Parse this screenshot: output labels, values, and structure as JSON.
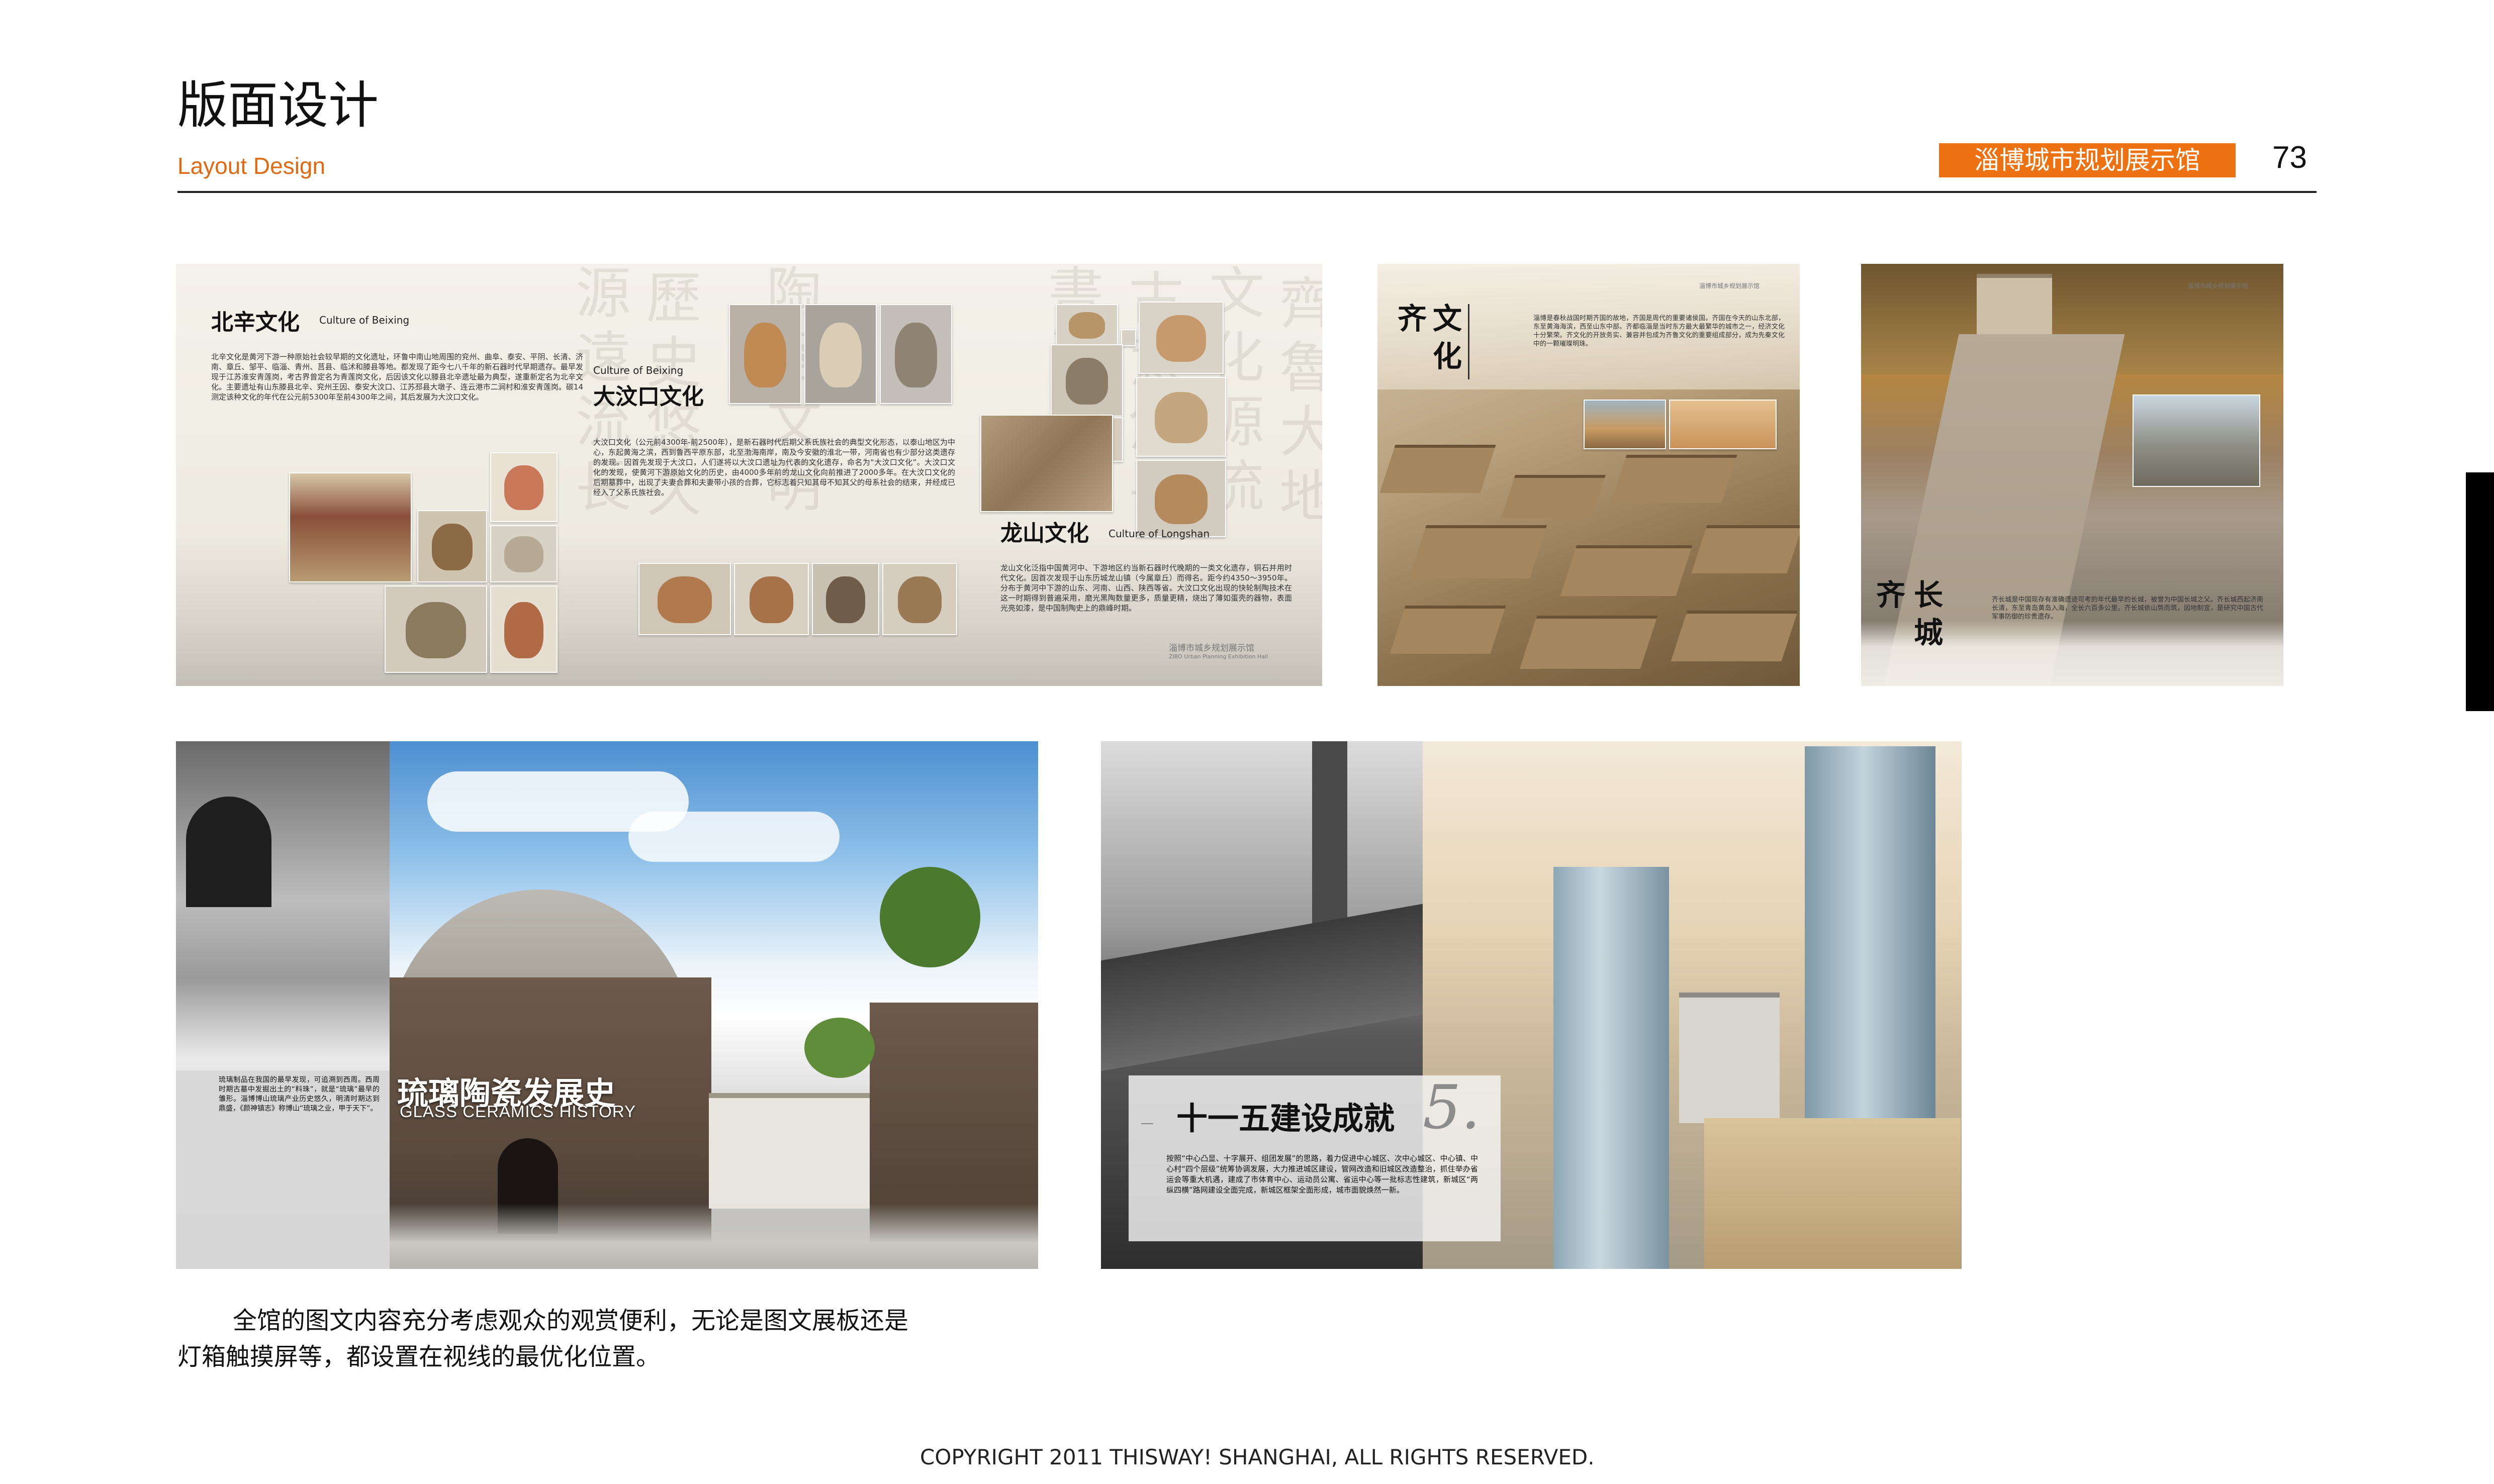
{
  "header": {
    "title_cn": "版面设计",
    "title_en": "Layout Design",
    "badge": "淄博城市规划展示馆",
    "page_number": "73"
  },
  "panel_culture": {
    "beixin": {
      "title": "北辛文化",
      "subtitle": "Culture of Beixing",
      "text": "北辛文化是黄河下游一种原始社会较早期的文化遗址，环鲁中南山地周围的兖州、曲阜、泰安、平阴、长清、济南、章丘、邹平、临淄、青州、莒县、临沭和滕县等地。都发现了距今七八千年的新石器时代早期遗存。最早发现于江苏淮安青莲岗，考古界曾定名为青莲岗文化，后因该文化以滕县北辛遗址最为典型，遂重新定名为北辛文化。主要遗址有山东滕县北辛、兖州王因、泰安大汶口、江苏邳县大墩子、连云港市二涧村和淮安青莲岗。碳14测定该种文化的年代在公元前5300年至前4300年之间，其后发展为大汶口文化。"
    },
    "dawenkou": {
      "subtitle": "Culture of Beixing",
      "title": "大汶口文化",
      "text": "大汶口文化（公元前4300年-前2500年），是新石器时代后期父系氏族社会的典型文化形态，以泰山地区为中心，东起黄海之滨，西到鲁西平原东部，北至渤海南岸，南及今安徽的淮北一带，河南省也有少部分这类遗存的发现。因首先发现于大汶口，人们遂将以大汶口遗址为代表的文化遗存，命名为“大汶口文化”。大汶口文化的发现，使黄河下游原始文化的历史，由4000多年前的龙山文化向前推进了2000多年。在大汶口文化的后期墓葬中，出现了夫妻合葬和夫妻带小孩的合葬，它标志着只知其母不知其父的母系社会的结束，并经成已经入了父系氏族社会。"
    },
    "longshan": {
      "title": "龙山文化",
      "subtitle": "Culture of Longshan",
      "text": "龙山文化泛指中国黄河中、下游地区约当新石器时代晚期的一类文化遗存，铜石并用时代文化。因首次发现于山东历城龙山镇（今属章丘）而得名。距今约4350～3950年。分布于黄河中下游的山东、河南、山西、陕西等省。大汶口文化出现的快轮制陶技术在这一时期得到普遍采用，磨光黑陶数量更多，质量更精，烧出了薄如蛋壳的器物，表面光亮如漆，是中国制陶史上的鼎峰时期。"
    },
    "footer": "淄博市城乡规划展示馆",
    "footer_en": "ZIBO Urban Planning Exhibition Hall"
  },
  "panel_qi_culture": {
    "title_chars": [
      "齐",
      "文",
      "化"
    ],
    "header_note": "淄博市城乡规划展示馆",
    "text": "淄博是春秋战国时期齐国的故地，齐国是周代的重要诸侯国。齐国在今天的山东北部，东至黄海海滨，西至山东中部。齐都临淄是当时东方最大最繁华的城市之一，经济文化十分繁荣。齐文化的开放务实、兼容并包成为齐鲁文化的重要组成部分，成为先秦文化中的一颗璀璨明珠。"
  },
  "panel_great_wall": {
    "title_chars": [
      "齐",
      "长",
      "城"
    ],
    "header_note": "淄博市城乡规划展示馆",
    "text": "齐长城是中国现存有准确遗迹可考的年代最早的长城，被誉为中国长城之父。齐长城西起济南长清，东至青岛黄岛入海，全长六百多公里。齐长城依山势而筑，因地制宜，是研究中国古代军事防御的珍贵遗存。"
  },
  "panel_ceramics": {
    "title": "琉璃陶瓷发展史",
    "subtitle": "GLASS CERAMICS HISTORY",
    "text": "琉璃制品在我国的最早发现，可追溯到西周。西周时期古墓中发掘出土的“料珠”，就是“琉璃”最早的雏形。淄博博山琉璃产业历史悠久，明清时期达到鼎盛，《颜神镇志》称博山“琉璃之业，甲于天下”。"
  },
  "panel_development": {
    "title": "十一五建设成就",
    "numeral": "5.",
    "text": "按照“中心凸显、十字展开、组团发展”的思路，着力促进中心城区、次中心城区、中心镇、中心村“四个层级”统筹协调发展，大力推进城区建设，管网改造和旧城区改造整治，抓住举办省运会等重大机遇，建成了市体育中心、运动员公寓、省运中心等一批标志性建筑，新城区“两纵四横”路网建设全面完成，新城区框架全面形成，城市面貌焕然一新。"
  },
  "body": {
    "line1": "全馆的图文内容充分考虑观众的观赏便利，无论是图文展板还是",
    "line2": "灯箱触摸屏等，都设置在视线的最优化位置。"
  },
  "footer": {
    "copyright": "COPYRIGHT 2011 THISWAY! SHANGHAI, ALL RIGHTS RESERVED."
  },
  "colors": {
    "accent": "#ee7212",
    "rule": "#222222"
  }
}
